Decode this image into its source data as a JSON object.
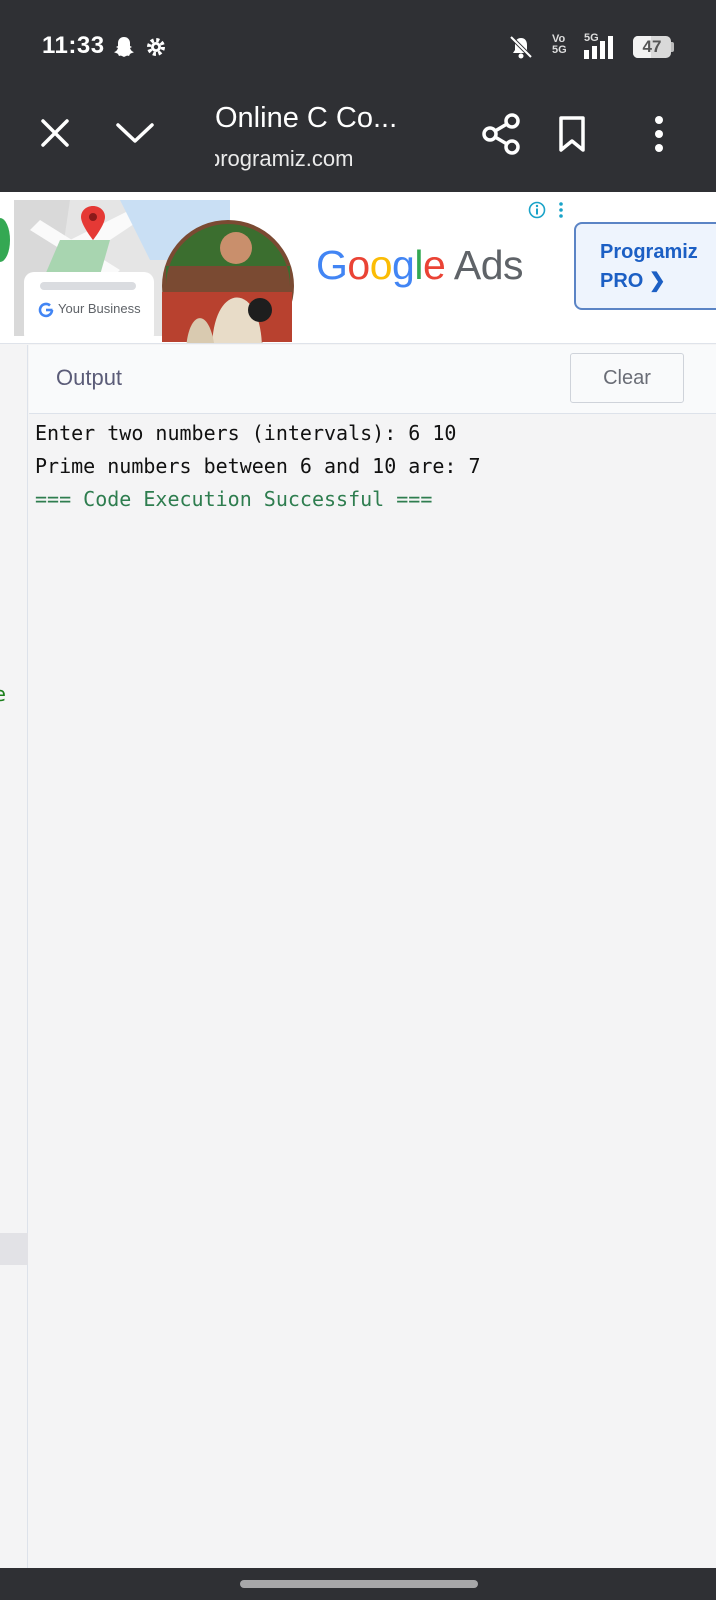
{
  "status_bar": {
    "time": "11:33",
    "left_icons": [
      "snapchat-icon",
      "settings-gear-icon"
    ],
    "right_icons": [
      "mute-icon",
      "volte-icon",
      "signal-icon",
      "battery-icon"
    ],
    "volte_label": "Vo\n5G",
    "network_label": "5G",
    "battery_level": "47",
    "battery_fraction": 0.47
  },
  "browser_toolbar": {
    "page_title": "Online C Co...",
    "url": "programiz.com"
  },
  "ad_banner": {
    "business_label": "Your Business",
    "logo_text": [
      "G",
      "o",
      "o",
      "g",
      "l",
      "e",
      " Ads"
    ],
    "logo_colors": [
      "#4285F4",
      "#EA4335",
      "#FBBC05",
      "#4285F4",
      "#34A853",
      "#EA4335",
      "#5f6368"
    ],
    "pro_button_line1": "Programiz",
    "pro_button_line2": "PRO ❯"
  },
  "output": {
    "title": "Output",
    "clear_label": "Clear",
    "lines": [
      "Enter two numbers (intervals): 6 10",
      "Prime numbers between 6 and 10 are: 7",
      "",
      "=== Code Execution Successful ==="
    ]
  },
  "editor_edge": {
    "visible_char": "e"
  },
  "colors": {
    "system_bar": "#2f3034",
    "success_text": "#2e7d4f",
    "accent_blue": "#1c5fc4"
  }
}
